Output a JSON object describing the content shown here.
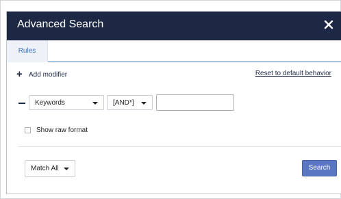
{
  "dialog": {
    "title": "Advanced Search",
    "close_icon": "close-icon"
  },
  "tabs": [
    {
      "label": "Rules",
      "active": true
    }
  ],
  "rules": {
    "add_modifier_label": "Add modifier",
    "reset_label": "Reset to default behavior",
    "rows": [
      {
        "field": "Keywords",
        "operator": "[AND*]",
        "value": ""
      }
    ]
  },
  "options": {
    "show_raw_format_label": "Show raw format",
    "show_raw_format_checked": false
  },
  "footer": {
    "match_mode": "Match All",
    "search_label": "Search"
  },
  "colors": {
    "header_bg": "#1d2944",
    "accent": "#3b6fb8",
    "search_button": "#5b77c1"
  }
}
